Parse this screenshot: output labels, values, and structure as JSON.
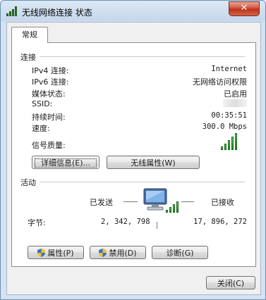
{
  "window": {
    "title": "无线网络连接 状态",
    "close_glyph": "✕"
  },
  "tabs": [
    {
      "label": "常规"
    }
  ],
  "connection": {
    "section_title": "连接",
    "rows": [
      {
        "label": "IPv4 连接:",
        "value": "Internet"
      },
      {
        "label": "IPv6 连接:",
        "value": "无网络访问权限"
      },
      {
        "label": "媒体状态:",
        "value": "已启用"
      },
      {
        "label": "SSID:",
        "value": ""
      },
      {
        "label": "持续时间:",
        "value": "00:35:51"
      },
      {
        "label": "速度:",
        "value": "300.0 Mbps"
      }
    ],
    "signal_label": "信号质量:",
    "signal_bars_lit": 5,
    "signal_bars_total": 5,
    "details_button": "详细信息(E)...",
    "wireless_props_button": "无线属性(W)"
  },
  "activity": {
    "section_title": "活动",
    "sent_label": "已发送",
    "received_label": "已接收",
    "bytes_label": "字节:",
    "bytes_sent": "2, 342, 798",
    "bytes_received": "17, 896, 272"
  },
  "actions": {
    "properties_button": "属性(P)",
    "disable_button": "禁用(D)",
    "diagnose_button": "诊断(G)"
  },
  "footer": {
    "close_button": "关闭(C)"
  },
  "icons": {
    "app": "wireless-signal-icon",
    "monitor": "network-monitor-icon",
    "shield": "uac-shield-icon"
  },
  "colors": {
    "accent": "#2f8a2f",
    "titlebar": "#c5d7ea",
    "close": "#c8402a"
  }
}
